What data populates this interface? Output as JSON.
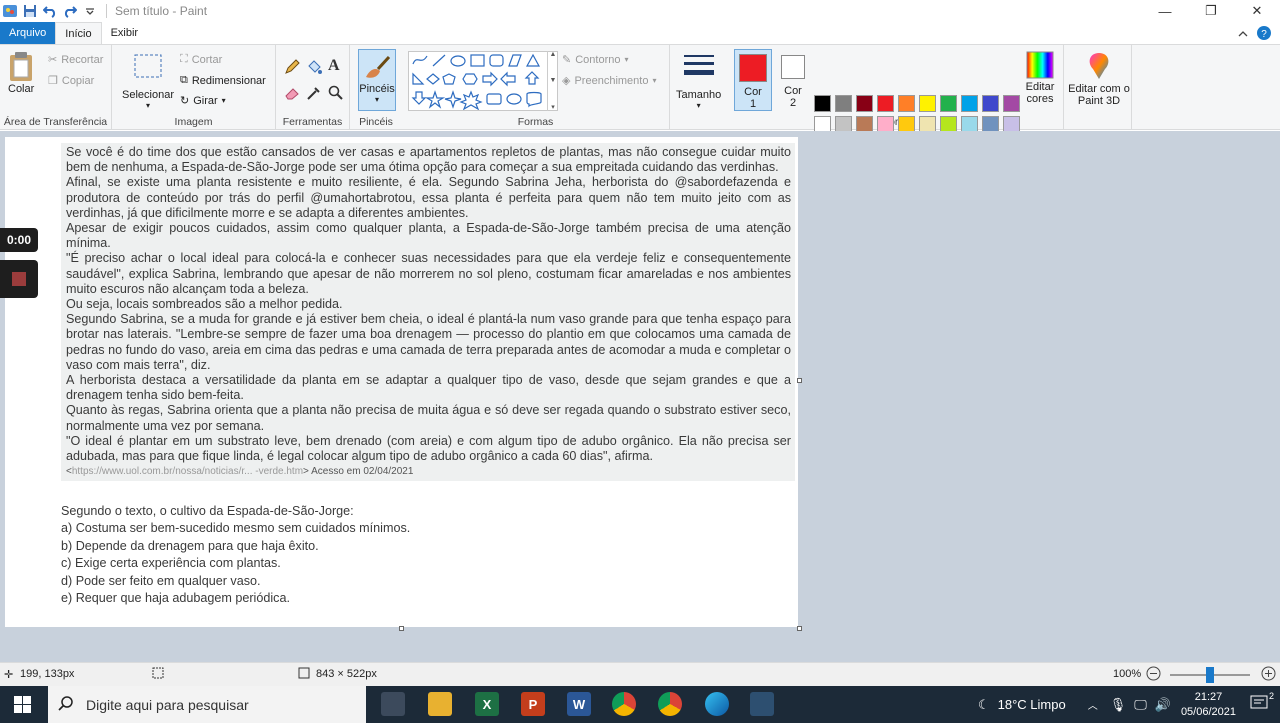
{
  "window": {
    "title": "Sem título - Paint"
  },
  "tabs": {
    "file": "Arquivo",
    "home": "Início",
    "view": "Exibir"
  },
  "ribbon": {
    "clipboard": {
      "paste": "Colar",
      "cut": "Recortar",
      "copy": "Copiar",
      "label": "Área de Transferência"
    },
    "image": {
      "select": "Selecionar",
      "crop": "Cortar",
      "resize": "Redimensionar",
      "rotate": "Girar",
      "label": "Imagem"
    },
    "tools": {
      "label": "Ferramentas"
    },
    "brushes": {
      "label": "Pincéis"
    },
    "shapes": {
      "outline": "Contorno",
      "fill": "Preenchimento",
      "label": "Formas"
    },
    "size": {
      "label": "Tamanho"
    },
    "colors": {
      "color1": "Cor 1",
      "color2": "Cor 2",
      "edit": "Editar cores",
      "paint3d": "Editar com o Paint 3D",
      "label": "Cores",
      "color1_value": "#ed1c24",
      "color2_value": "#ffffff",
      "palette": [
        "#000000",
        "#7f7f7f",
        "#880015",
        "#ed1c24",
        "#ff7f27",
        "#fff200",
        "#22b14c",
        "#00a2e8",
        "#3f48cc",
        "#a349a4",
        "#ffffff",
        "#c3c3c3",
        "#b97a57",
        "#ffaec9",
        "#ffc90e",
        "#efe4b0",
        "#b5e61d",
        "#99d9ea",
        "#7092be",
        "#c8bfe7",
        "#ffffff",
        "#ffffff",
        "#ffffff",
        "#ffffff",
        "#ffffff",
        "#ffffff",
        "#ffffff",
        "#ffffff",
        "#ffffff",
        "#ffffff"
      ]
    }
  },
  "article": {
    "paragraphs": [
      "Se você é do time dos que estão cansados de ver casas e apartamentos repletos de plantas, mas não consegue cuidar muito bem de nenhuma, a Espada-de-São-Jorge pode ser uma ótima opção para começar a sua empreitada cuidando das verdinhas.",
      "Afinal, se existe uma planta resistente e muito resiliente, é ela. Segundo Sabrina Jeha, herborista do @saborde­fazenda e produtora de conteúdo por trás do perfil @umahortabrotou, essa planta é perfeita para quem não tem muito jeito com as verdinhas, já que dificilmente morre e se adapta a diferentes ambientes.",
      "Apesar de exigir poucos cuidados, assim como qualquer planta, a Espada-de-São-Jorge também precisa de uma atenção mínima.",
      "\"É preciso achar o local ideal para colocá-la e conhecer suas necessidades para que ela verdeje feliz e consequentemente saudável\", explica Sabrina, lembrando que apesar de não morrerem no sol pleno, costumam ficar amareladas e nos ambientes muito escuros não alcançam toda a beleza.",
      "Ou seja, locais sombreados são a melhor pedida.",
      "Segundo Sabrina, se a muda for grande e já estiver bem cheia, o ideal é plantá-la num vaso grande para que tenha espaço para brotar nas laterais. \"Lembre-se sempre de fazer uma boa drenagem — processo do plantio em que colocamos uma camada de pedras no fundo do vaso, areia em cima das pedras e uma camada de terra preparada antes de acomodar a muda e completar o vaso com mais terra\", diz.",
      "A herborista destaca a versatilidade da planta em se adaptar a qualquer tipo de vaso, desde que sejam grandes e que a drenagem tenha sido bem-feita.",
      "Quanto às regas, Sabrina orienta que a planta não precisa de muita água e só deve ser regada quando o substrato estiver seco, normalmente uma vez por semana.",
      "\"O ideal é plantar em um substrato leve, bem drenado (com areia) e com algum tipo de adubo orgânico. Ela não precisa ser adubada, mas para que fique linda, é legal colocar algum tipo de adubo orgânico a cada 60 dias\", afirma."
    ],
    "source_prefix": "<",
    "source_url": "https://www.uol.com.br/nossa/noticias/r... -verde.htm",
    "source_suffix": "> Acesso em 02/04/2021"
  },
  "question": {
    "stem": "Segundo o texto, o cultivo da Espada-de-São-Jorge:",
    "options": [
      "a) Costuma ser bem-sucedido mesmo sem cuidados mínimos.",
      "b) Depende da drenagem para que haja êxito.",
      "c) Exige certa experiência com plantas.",
      "d) Pode ser feito em qualquer vaso.",
      "e) Requer que haja adubagem periódica."
    ]
  },
  "overlay": {
    "timer": "0:00"
  },
  "status": {
    "cursor": "199, 133px",
    "size": "843 × 522px",
    "zoom": "100%",
    "zoom_level": 0.5
  },
  "taskbar": {
    "search_placeholder": "Digite aqui para pesquisar",
    "weather": "18°C  Limpo",
    "time": "21:27",
    "date": "05/06/2021",
    "notifications": "2"
  }
}
